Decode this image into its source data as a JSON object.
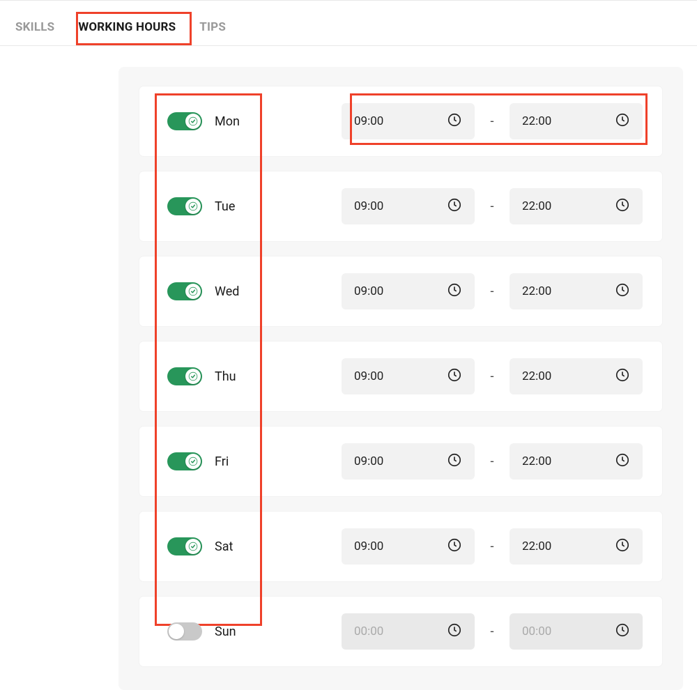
{
  "tabs": [
    {
      "label": "SKILLS",
      "active": false
    },
    {
      "label": "WORKING HOURS",
      "active": true
    },
    {
      "label": "TIPS",
      "active": false
    }
  ],
  "timeSeparator": "-",
  "days": [
    {
      "label": "Mon",
      "enabled": true,
      "start": "09:00",
      "end": "22:00"
    },
    {
      "label": "Tue",
      "enabled": true,
      "start": "09:00",
      "end": "22:00"
    },
    {
      "label": "Wed",
      "enabled": true,
      "start": "09:00",
      "end": "22:00"
    },
    {
      "label": "Thu",
      "enabled": true,
      "start": "09:00",
      "end": "22:00"
    },
    {
      "label": "Fri",
      "enabled": true,
      "start": "09:00",
      "end": "22:00"
    },
    {
      "label": "Sat",
      "enabled": true,
      "start": "09:00",
      "end": "22:00"
    },
    {
      "label": "Sun",
      "enabled": false,
      "start": "00:00",
      "end": "00:00"
    }
  ]
}
